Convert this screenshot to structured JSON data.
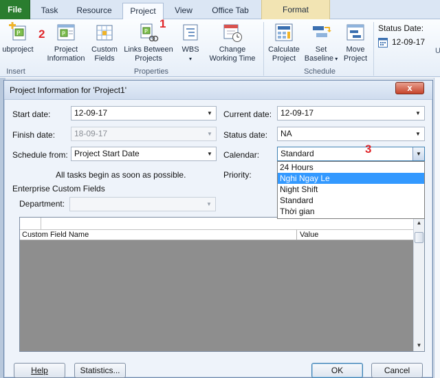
{
  "tabs": {
    "file": "File",
    "task": "Task",
    "resource": "Resource",
    "project": "Project",
    "view": "View",
    "office_tab": "Office Tab",
    "format": "Format"
  },
  "ribbon": {
    "subproject": "ubproject",
    "project_information": [
      "Project",
      "Information"
    ],
    "custom_fields": [
      "Custom",
      "Fields"
    ],
    "links_between_projects": [
      "Links Between",
      "Projects"
    ],
    "wbs": "WBS",
    "change_working_time": [
      "Change",
      "Working Time"
    ],
    "calculate_project": [
      "Calculate",
      "Project"
    ],
    "set_baseline": [
      "Set",
      "Baseline"
    ],
    "move_project": [
      "Move",
      "Project"
    ],
    "status_date_label": "Status Date:",
    "status_date_value": "12-09-17",
    "group_insert": "Insert",
    "group_properties": "Properties",
    "group_schedule": "Schedule",
    "right_cut": "U"
  },
  "markers": {
    "one": "1",
    "two": "2",
    "three": "3"
  },
  "dialog": {
    "title": "Project Information for 'Project1'",
    "close": "x",
    "start_date_label": "Start date:",
    "start_date_value": "12-09-17",
    "finish_date_label": "Finish date:",
    "finish_date_value": "18-09-17",
    "schedule_from_label": "Schedule from:",
    "schedule_from_value": "Project Start Date",
    "tasks_note": "All tasks begin as soon as possible.",
    "current_date_label": "Current date:",
    "current_date_value": "12-09-17",
    "status_date_label": "Status date:",
    "status_date_value": "NA",
    "calendar_label": "Calendar:",
    "calendar_value": "Standard",
    "priority_label": "Priority:",
    "enterprise_fields": "Enterprise Custom Fields",
    "department_label": "Department:",
    "department_value": "",
    "calendar_options": [
      "24 Hours",
      "Nghi Ngay Le",
      "Night Shift",
      "Standard",
      "Thời gian"
    ],
    "calendar_selected_index": 1,
    "grid_col_name": "Custom Field Name",
    "grid_col_value": "Value",
    "help": "Help",
    "statistics": "Statistics...",
    "ok": "OK",
    "cancel": "Cancel"
  },
  "colors": {
    "file_tab": "#2a7d2f",
    "marker": "#e0262a",
    "selection": "#3399ff",
    "close_button": "#c7442b"
  }
}
